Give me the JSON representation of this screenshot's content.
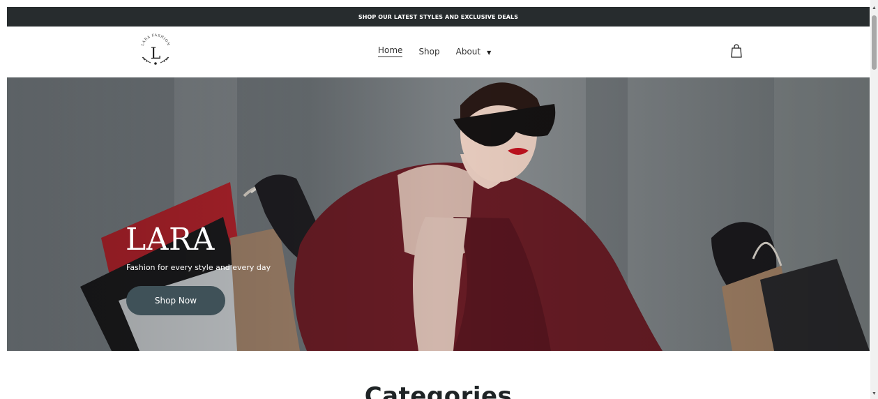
{
  "announcement": {
    "text": "SHOP OUR LATEST STYLES AND EXCLUSIVE DEALS"
  },
  "logo": {
    "name": "lara-fashion-logo",
    "arc_text": "LARA FASHION",
    "letter": "L"
  },
  "nav": {
    "home": "Home",
    "shop": "Shop",
    "about": "About",
    "about_caret": "▼"
  },
  "cart": {
    "icon": "shopping-bag-icon"
  },
  "hero": {
    "title": "LARA",
    "subtitle": "Fashion for every style and every day",
    "button": "Shop Now"
  },
  "section": {
    "title": "Categories"
  },
  "colors": {
    "announcement_bg": "#272c2e",
    "button_bg": "#3f5158",
    "coat": "#6b1d26"
  },
  "scrollbar": {
    "up": "▲",
    "down": "▼"
  }
}
